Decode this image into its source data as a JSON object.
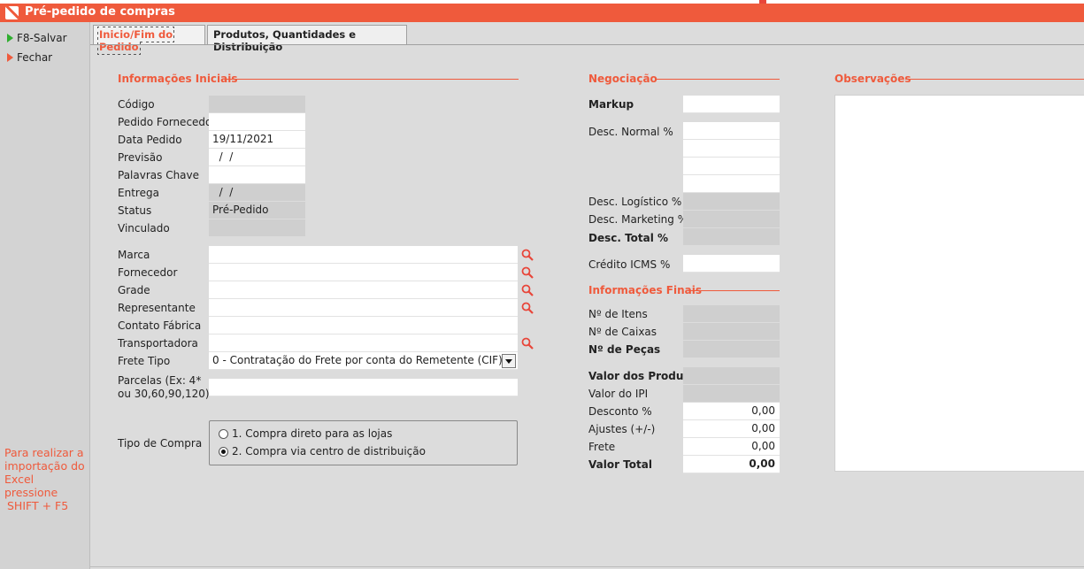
{
  "window": {
    "title": "Pré-pedido de compras"
  },
  "sidebar": {
    "save_label": "F8-Salvar",
    "close_label": "Fechar",
    "hint_lines": [
      "Para realizar a",
      "importação do",
      "Excel pressione",
      "SHIFT + F5"
    ]
  },
  "tabs": [
    {
      "label": "Inicio/Fim do Pedido",
      "active": true
    },
    {
      "label": "Produtos, Quantidades e Distribuição",
      "active": false
    }
  ],
  "info": {
    "title": "Informações Iniciais",
    "codigo": {
      "label": "Código",
      "value": ""
    },
    "pedido_fornecedor": {
      "label": "Pedido Fornecedor",
      "value": ""
    },
    "data_pedido": {
      "label": "Data Pedido",
      "value": "19/11/2021"
    },
    "previsao": {
      "label": "Previsão",
      "value": "  /  /"
    },
    "palavras_chave": {
      "label": "Palavras Chave",
      "value": ""
    },
    "entrega": {
      "label": "Entrega",
      "value": "  /  /"
    },
    "status": {
      "label": "Status",
      "value": "Pré-Pedido"
    },
    "vinculado": {
      "label": "Vinculado",
      "value": ""
    },
    "marca": {
      "label": "Marca",
      "value": ""
    },
    "fornecedor": {
      "label": "Fornecedor",
      "value": ""
    },
    "grade": {
      "label": "Grade",
      "value": ""
    },
    "representante": {
      "label": "Representante",
      "value": ""
    },
    "contato_fabrica": {
      "label": "Contato Fábrica",
      "value": ""
    },
    "transportadora": {
      "label": "Transportadora",
      "value": ""
    },
    "frete_tipo": {
      "label": "Frete Tipo",
      "value": "0 - Contratação do Frete por conta do Remetente (CIF)"
    },
    "parcelas": {
      "label_line1": "Parcelas (Ex: 4*",
      "label_line2": "ou 30,60,90,120)",
      "value": ""
    },
    "tipo_compra": {
      "label": "Tipo de Compra",
      "options": [
        "1. Compra direto para as lojas",
        "2. Compra via centro de distribuição"
      ],
      "selected_index": 1
    }
  },
  "negociacao": {
    "title": "Negociação",
    "markup": {
      "label": "Markup",
      "value": ""
    },
    "desc_normal": {
      "label": "Desc. Normal %",
      "values": [
        "",
        "",
        "",
        ""
      ]
    },
    "desc_logistico": {
      "label": "Desc. Logístico %",
      "value": ""
    },
    "desc_marketing": {
      "label": "Desc. Marketing %",
      "value": ""
    },
    "desc_total": {
      "label": "Desc. Total %",
      "value": ""
    },
    "credito_icms": {
      "label": "Crédito ICMS %",
      "value": ""
    }
  },
  "finais": {
    "title": "Informações Finais",
    "n_itens": {
      "label": "Nº de Itens",
      "value": ""
    },
    "n_caixas": {
      "label": "Nº de Caixas",
      "value": ""
    },
    "n_pecas": {
      "label": "Nº de Peças",
      "value": ""
    },
    "valor_produtos": {
      "label": "Valor dos Produtos",
      "value": ""
    },
    "valor_ipi": {
      "label": "Valor do IPI",
      "value": ""
    },
    "desconto": {
      "label": "Desconto %",
      "value": "0,00"
    },
    "ajustes": {
      "label": "Ajustes (+/-)",
      "value": "0,00"
    },
    "frete": {
      "label": "Frete",
      "value": "0,00"
    },
    "valor_total": {
      "label": "Valor Total",
      "value": "0,00"
    }
  },
  "observacoes": {
    "title": "Observações",
    "value": ""
  },
  "colors": {
    "accent": "#ef5a3c",
    "background": "#dcdcdc",
    "readonly_field": "#cfcfcf"
  },
  "icons": {
    "lookup": "magnifier-icon",
    "save": "play-green-icon",
    "close": "play-red-icon"
  }
}
